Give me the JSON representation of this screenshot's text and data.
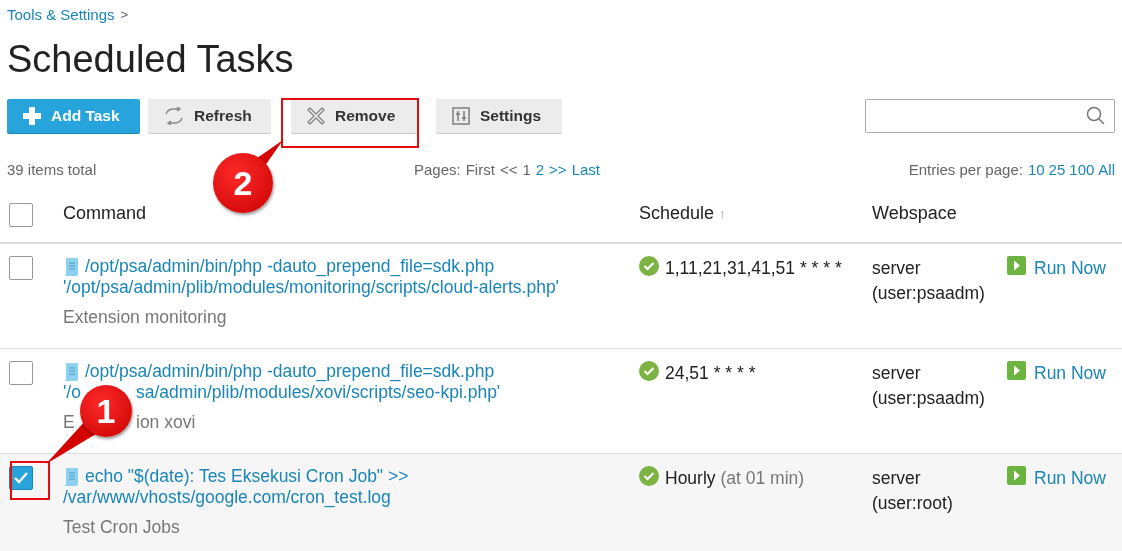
{
  "breadcrumb": {
    "label": "Tools & Settings",
    "separator": ">"
  },
  "title": "Scheduled Tasks",
  "toolbar": [
    {
      "kind": "primary",
      "label": "Add Task"
    },
    {
      "kind": "default",
      "label": "Refresh"
    },
    {
      "kind": "default",
      "label": "Remove"
    },
    {
      "kind": "default",
      "label": "Settings"
    }
  ],
  "summary": "39 items total",
  "pager": {
    "label": "Pages:",
    "items": [
      {
        "label": "First",
        "disabled": true
      },
      {
        "label": "<<",
        "disabled": true
      },
      {
        "label": "1",
        "disabled": true
      },
      {
        "label": "2",
        "disabled": false
      },
      {
        "label": ">>",
        "disabled": false
      },
      {
        "label": "Last",
        "disabled": false
      }
    ]
  },
  "per_page": {
    "label": "Entries per page:",
    "options": [
      "10",
      "25",
      "100",
      "All"
    ]
  },
  "table": {
    "select_all_checked": false,
    "columns": [
      {
        "label": "Command",
        "sorted": false
      },
      {
        "label": "Schedule",
        "sorted": true,
        "sort_mark": "↑"
      },
      {
        "label": "Webspace",
        "sorted": false
      }
    ],
    "rows": [
      {
        "checked": false,
        "command": [
          [
            "/opt/psa/admin/bin/php -dauto_prepend_file=sdk.php"
          ],
          [
            "'/opt/psa/admin/plib/modules/monitoring/scripts/cloud-alerts.php'"
          ]
        ],
        "description": [
          "Extension monitoring"
        ],
        "schedule": "1,11,21,31,41,51 * * * *",
        "webspace": [
          "server",
          "(user:psaadm)"
        ],
        "action": "Run Now"
      },
      {
        "checked": false,
        "command": [
          [
            "/opt/psa/admin/bin/php -dauto_prepend_file=sdk.php"
          ],
          [
            "'/o",
            "sa/admin/plib/modules/xovi/scripts/seo-kpi.php'"
          ]
        ],
        "description": [
          "E",
          "ion xovi"
        ],
        "schedule": "24,51 * * * *",
        "webspace": [
          "server",
          "(user:psaadm)"
        ],
        "action": "Run Now"
      },
      {
        "checked": true,
        "command": [
          [
            "echo \"$(date): Tes Eksekusi Cron Job\" >>"
          ],
          [
            "/var/www/vhosts/google.com/cron_test.log"
          ]
        ],
        "description": [
          "Test Cron Jobs"
        ],
        "schedule": "Hourly",
        "schedule_note": "(at 01 min)",
        "webspace": [
          "server",
          "(user:root)"
        ],
        "action": "Run Now"
      }
    ]
  },
  "callouts": [
    {
      "label": "2"
    },
    {
      "label": "1"
    }
  ]
}
